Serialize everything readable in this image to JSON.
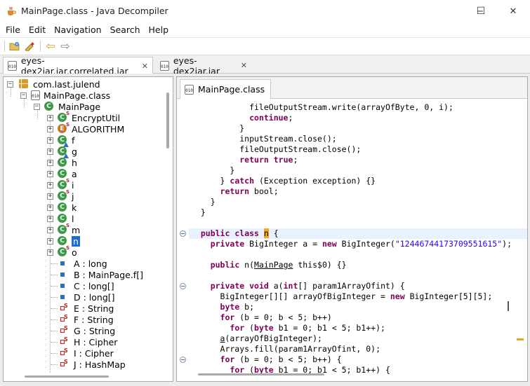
{
  "window": {
    "title": "MainPage.class - Java Decompiler",
    "minimize_glyph": "─",
    "maximize_glyph": "☐",
    "close_glyph": "✕"
  },
  "menu": [
    "File",
    "Edit",
    "Navigation",
    "Search",
    "Help"
  ],
  "toolbar": {
    "icons": [
      "open-folder-icon",
      "open-type-icon",
      "back-arrow-icon",
      "forward-arrow-icon"
    ],
    "back_glyph": "⇦",
    "forward_glyph": "⇨"
  },
  "jar_icon_text": "010",
  "outer_tabs": [
    {
      "label": "eyes-dex2jar.jar.correlated.jar",
      "close": "✕",
      "active": true
    },
    {
      "label": "eyes-dex2jar.jar",
      "close": "✕",
      "active": false
    }
  ],
  "tree": [
    {
      "label": "com.last.julend",
      "icon": "package-icon",
      "toggle": "−"
    },
    {
      "label": "MainPage.class",
      "icon": "class-file-icon",
      "toggle": "−"
    },
    {
      "label": "MainPage",
      "icon": "class-icon",
      "toggle": "−"
    },
    {
      "label": "EncryptUtil",
      "icon": "inner-class-icon",
      "toggle": "+"
    },
    {
      "label": "ALGORITHM",
      "icon": "enum-icon",
      "toggle": "+"
    },
    {
      "label": "f",
      "icon": "abstract-class-icon",
      "toggle": "+"
    },
    {
      "label": "g",
      "icon": "abstract-class-icon",
      "toggle": "+"
    },
    {
      "label": "h",
      "icon": "class-icon",
      "toggle": "+"
    },
    {
      "label": "a",
      "icon": "class-icon",
      "toggle": "+"
    },
    {
      "label": "i",
      "icon": "inner-class-icon",
      "toggle": "+"
    },
    {
      "label": "j",
      "icon": "inner-class-icon",
      "toggle": "+"
    },
    {
      "label": "k",
      "icon": "class-icon",
      "toggle": "+"
    },
    {
      "label": "l",
      "icon": "class-icon",
      "toggle": "+"
    },
    {
      "label": "m",
      "icon": "inner-class-icon",
      "toggle": "+"
    },
    {
      "label": "n",
      "icon": "class-icon",
      "toggle": "+",
      "selected": true
    },
    {
      "label": "o",
      "icon": "inner-class-icon",
      "toggle": "+"
    },
    {
      "label": "A : long",
      "icon": "field-icon"
    },
    {
      "label": "B : MainPage.f[]",
      "icon": "field-icon"
    },
    {
      "label": "C : long[]",
      "icon": "field-icon"
    },
    {
      "label": "D : long[]",
      "icon": "field-icon"
    },
    {
      "label": "E : String",
      "icon": "private-static-field-icon"
    },
    {
      "label": "F : String",
      "icon": "private-static-field-icon"
    },
    {
      "label": "G : String",
      "icon": "private-static-field-icon"
    },
    {
      "label": "H : Cipher",
      "icon": "private-static-field-icon"
    },
    {
      "label": "I : Cipher",
      "icon": "private-static-field-icon"
    },
    {
      "label": "J : HashMap",
      "icon": "private-static-field-icon"
    }
  ],
  "code_tab": {
    "label": "MainPage.class"
  },
  "code_lines": [
    "            fileOutputStream.write(arrayOfByte, 0, i);",
    "            continue;",
    "          }",
    "          inputStream.close();",
    "          fileOutputStream.close();",
    "          return true;",
    "        }",
    "      } catch (Exception exception) {}",
    "      return bool;",
    "    }",
    "  }",
    "",
    "  public class n {",
    "    private BigInteger a = new BigInteger(\"12446744173709551615\");",
    "",
    "    public n(MainPage this$0) {}",
    "",
    "    private void a(int[] param1ArrayOfint) {",
    "      BigInteger[][] arrayOfBigInteger = new BigInteger[5][5];",
    "      byte b;",
    "      for (b = 0; b < 5; b++)",
    "        for (byte b1 = 0; b1 < 5; b1++);",
    "      a(arrayOfBigInteger);",
    "      Arrays.fill(param1ArrayOfint, 0);",
    "      for (b = 0; b < 5; b++) {",
    "        for (byte b1 = 0; b1 < 5; b1++) {"
  ]
}
